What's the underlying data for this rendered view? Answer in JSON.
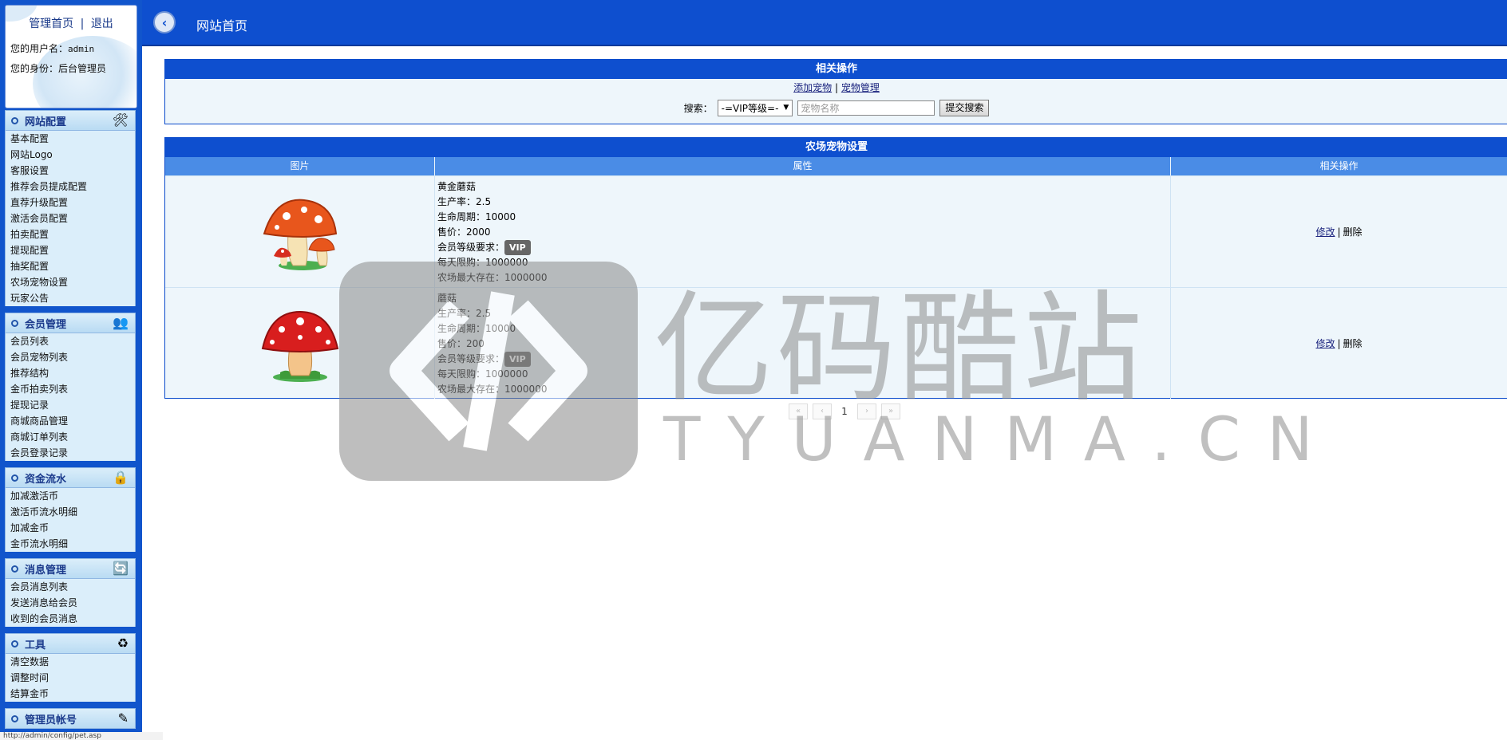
{
  "sidebar": {
    "top_links": {
      "home": "管理首页",
      "sep": "|",
      "logout": "退出"
    },
    "user_label": "您的用户名：",
    "username": "admin",
    "role_label": "您的身份：",
    "role": "后台管理员",
    "groups": [
      {
        "title": "网站配置",
        "icon": "🛠",
        "items": [
          "基本配置",
          "网站Logo",
          "客服设置",
          "推荐会员提成配置",
          "直荐升级配置",
          "激活会员配置",
          "拍卖配置",
          "提现配置",
          "抽奖配置",
          "农场宠物设置",
          "玩家公告"
        ]
      },
      {
        "title": "会员管理",
        "icon": "👥",
        "items": [
          "会员列表",
          "会员宠物列表",
          "推荐结构",
          "金币拍卖列表",
          "提现记录",
          "商城商品管理",
          "商城订单列表",
          "会员登录记录"
        ]
      },
      {
        "title": "资金流水",
        "icon": "🔒",
        "items": [
          "加减激活币",
          "激活币流水明细",
          "加减金币",
          "金币流水明细"
        ]
      },
      {
        "title": "消息管理",
        "icon": "🔄",
        "items": [
          "会员消息列表",
          "发送消息给会员",
          "收到的会员消息"
        ]
      },
      {
        "title": "工具",
        "icon": "♻",
        "items": [
          "清空数据",
          "调整时间",
          "结算金币"
        ]
      },
      {
        "title": "管理员帐号",
        "icon": "✎",
        "items": []
      }
    ]
  },
  "header": {
    "title": "网站首页"
  },
  "ops_panel": {
    "title": "相关操作",
    "add_link": "添加宠物",
    "sep": "|",
    "manage_link": "宠物管理",
    "search_label": "搜索：",
    "vip_select": "-=VIP等级=-",
    "name_placeholder": "宠物名称",
    "submit": "提交搜索"
  },
  "pets_panel": {
    "title": "农场宠物设置",
    "columns": [
      "图片",
      "属性",
      "相关操作"
    ],
    "labels": {
      "rate": "生产率：",
      "life": "生命周期：",
      "price": "售价：",
      "vip": "会员等级要求：",
      "daily": "每天限购：",
      "max": "农场最大存在："
    },
    "rows": [
      {
        "name": "黄金蘑菇",
        "rate": "2.5",
        "life": "10000",
        "price": "2000",
        "vip": "VIP",
        "daily": "1000000",
        "max": "1000000",
        "edit": "修改",
        "sep": "|",
        "delete": "删除"
      },
      {
        "name": "蘑菇",
        "rate": "2.5",
        "life": "10000",
        "price": "200",
        "vip": "VIP",
        "daily": "1000000",
        "max": "1000000",
        "edit": "修改",
        "sep": "|",
        "delete": "删除"
      }
    ]
  },
  "pager": {
    "first": "«",
    "prev": "‹",
    "current": "1",
    "next": "›",
    "last": "»"
  },
  "watermark": {
    "main": "亿码酷站",
    "sub": "TYUANMA.CN"
  },
  "status": "http://admin/config/pet.asp"
}
